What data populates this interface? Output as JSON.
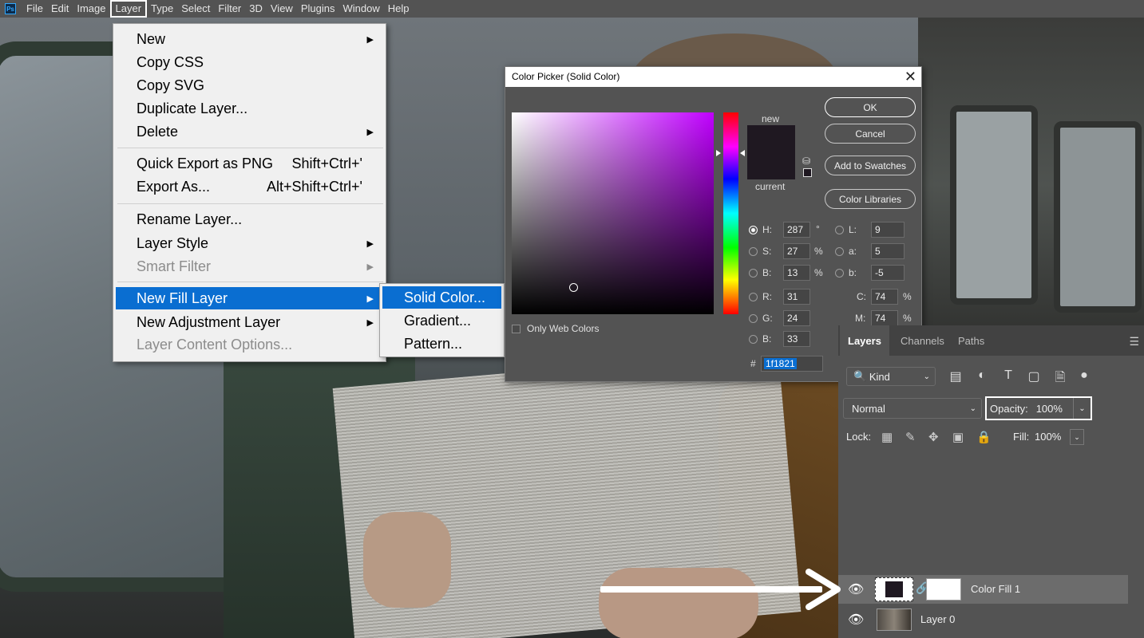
{
  "menubar": {
    "logo": "Ps",
    "items": [
      "File",
      "Edit",
      "Image",
      "Layer",
      "Type",
      "Select",
      "Filter",
      "3D",
      "View",
      "Plugins",
      "Window",
      "Help"
    ]
  },
  "layer_menu": {
    "items": {
      "new": "New",
      "copy_css": "Copy CSS",
      "copy_svg": "Copy SVG",
      "duplicate": "Duplicate Layer...",
      "delete": "Delete",
      "quick_export": "Quick Export as PNG",
      "quick_export_sc": "Shift+Ctrl+'",
      "export_as": "Export As...",
      "export_as_sc": "Alt+Shift+Ctrl+'",
      "rename": "Rename Layer...",
      "layer_style": "Layer Style",
      "smart_filter": "Smart Filter",
      "new_fill": "New Fill Layer",
      "new_adjustment": "New Adjustment Layer",
      "content_options": "Layer Content Options..."
    }
  },
  "fill_submenu": {
    "solid": "Solid Color...",
    "gradient": "Gradient...",
    "pattern": "Pattern..."
  },
  "color_picker": {
    "title": "Color Picker (Solid Color)",
    "close": "✕",
    "new_label": "new",
    "current_label": "current",
    "buttons": {
      "ok": "OK",
      "cancel": "Cancel",
      "add_swatches": "Add to Swatches",
      "libraries": "Color Libraries"
    },
    "fields": {
      "H": "287",
      "S": "27",
      "B": "13",
      "R": "31",
      "G": "24",
      "Bv": "33",
      "L": "9",
      "a": "5",
      "b": "-5",
      "C": "74",
      "M": "74"
    },
    "labels": {
      "H": "H:",
      "S": "S:",
      "B": "B:",
      "R": "R:",
      "G": "G:",
      "B2": "B:",
      "L": "L:",
      "a": "a:",
      "b": "b:",
      "C": "C:",
      "M": "M:",
      "deg": "°",
      "pct": "%",
      "hash": "#"
    },
    "hex": "1f1821",
    "only_web": "Only Web Colors",
    "color": "#1f1821"
  },
  "layers_panel": {
    "tabs": [
      "Layers",
      "Channels",
      "Paths"
    ],
    "kind": "Kind",
    "blend_mode": "Normal",
    "opacity_label": "Opacity:",
    "opacity_value": "100%",
    "lock_label": "Lock:",
    "fill_label": "Fill:",
    "fill_value": "100%",
    "layers": [
      {
        "name": "Color Fill 1"
      },
      {
        "name": "Layer 0"
      }
    ]
  }
}
